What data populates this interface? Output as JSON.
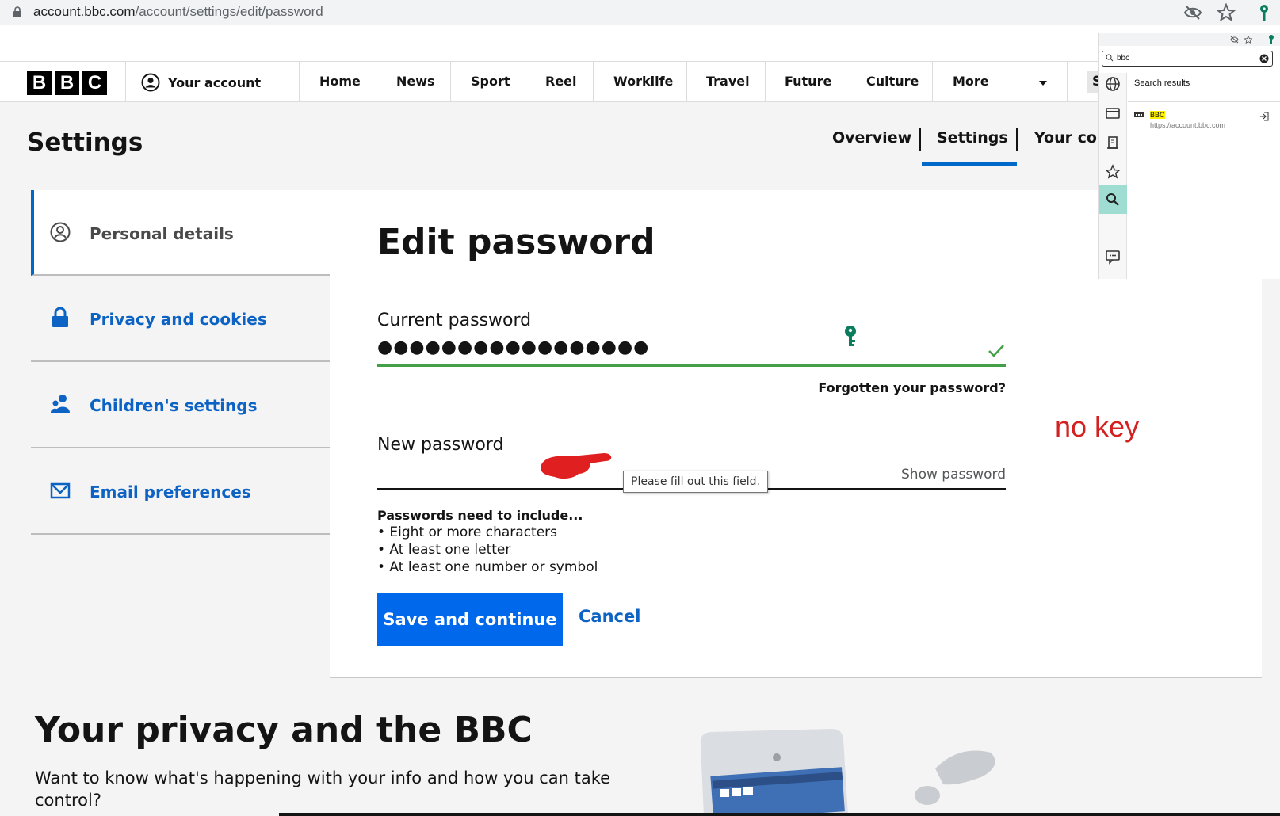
{
  "browser": {
    "url_host": "account.bbc.com",
    "url_path": "/account/settings/edit/password"
  },
  "nav": {
    "logo_letters": [
      "B",
      "B",
      "C"
    ],
    "your_account": "Your account",
    "items": [
      "Home",
      "News",
      "Sport",
      "Reel",
      "Worklife",
      "Travel",
      "Future",
      "Culture",
      "More"
    ],
    "search_stub": "S"
  },
  "header": {
    "title": "Settings",
    "tabs": [
      "Overview",
      "Settings",
      "Your con"
    ]
  },
  "sidebar": {
    "items": [
      {
        "label": "Personal details",
        "icon": "user-circle-icon"
      },
      {
        "label": "Privacy and cookies",
        "icon": "lock-icon"
      },
      {
        "label": "Children's settings",
        "icon": "children-icon"
      },
      {
        "label": "Email preferences",
        "icon": "envelope-icon"
      }
    ]
  },
  "form": {
    "title": "Edit password",
    "current_label": "Current password",
    "current_value": "●●●●●●●●●●●●●●●●●",
    "forgot": "Forgotten your password?",
    "new_label": "New password",
    "show_password": "Show password",
    "tooltip": "Please fill out this field.",
    "annotation": "no key",
    "requirements_title": "Passwords need to include...",
    "requirements": [
      "• Eight or more characters",
      "• At least one letter",
      "• At least one number or symbol"
    ],
    "save": "Save and continue",
    "cancel": "Cancel"
  },
  "privacy": {
    "title": "Your privacy and the BBC",
    "description": "Want to know what's happening with your info and how you can take control?"
  },
  "extension": {
    "search_value": "bbc",
    "results_heading": "Search results",
    "result_name": "BBC",
    "result_url": "https://account.bbc.com"
  },
  "colors": {
    "accent_blue": "#0068ea",
    "link_blue": "#0c63c4",
    "success_green": "#43a047",
    "annotation_red": "#d32121",
    "extension_teal": "#9fdcd2"
  }
}
